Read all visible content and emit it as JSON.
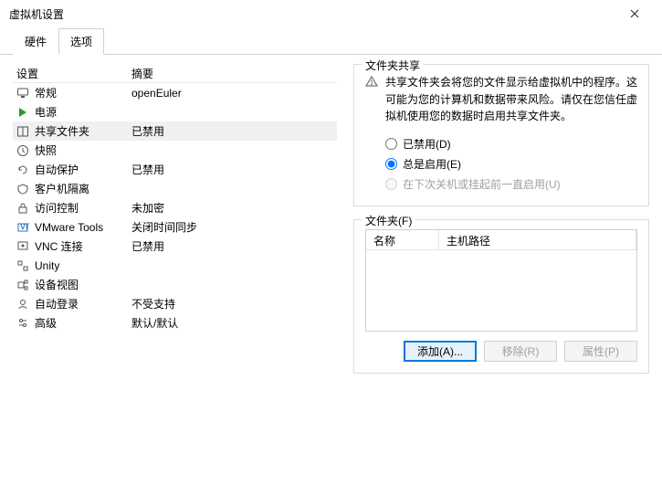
{
  "window": {
    "title": "虚拟机设置"
  },
  "tabs": {
    "hardware": "硬件",
    "options": "选项"
  },
  "list": {
    "header_device": "设置",
    "header_summary": "摘要",
    "rows": [
      {
        "name": "常规",
        "summary": "openEuler"
      },
      {
        "name": "电源",
        "summary": ""
      },
      {
        "name": "共享文件夹",
        "summary": "已禁用"
      },
      {
        "name": "快照",
        "summary": ""
      },
      {
        "name": "自动保护",
        "summary": "已禁用"
      },
      {
        "name": "客户机隔离",
        "summary": ""
      },
      {
        "name": "访问控制",
        "summary": "未加密"
      },
      {
        "name": "VMware Tools",
        "summary": "关闭时间同步"
      },
      {
        "name": "VNC 连接",
        "summary": "已禁用"
      },
      {
        "name": "Unity",
        "summary": ""
      },
      {
        "name": "设备视图",
        "summary": ""
      },
      {
        "name": "自动登录",
        "summary": "不受支持"
      },
      {
        "name": "高级",
        "summary": "默认/默认"
      }
    ]
  },
  "share": {
    "group_title": "文件夹共享",
    "warning": "共享文件夹会将您的文件显示给虚拟机中的程序。这可能为您的计算机和数据带来风险。请仅在您信任虚拟机使用您的数据时启用共享文件夹。",
    "radio_disabled": "已禁用(D)",
    "radio_always": "总是启用(E)",
    "radio_nextboot": "在下次关机或挂起前一直启用(U)"
  },
  "folders": {
    "group_title": "文件夹(F)",
    "col_name": "名称",
    "col_path": "主机路径",
    "btn_add": "添加(A)...",
    "btn_remove": "移除(R)",
    "btn_props": "属性(P)"
  }
}
